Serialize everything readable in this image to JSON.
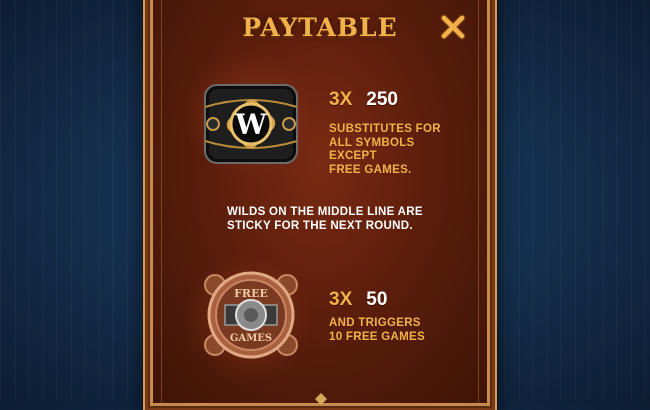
{
  "paytable": {
    "title": "PAYTABLE",
    "close_icon": "close-x-icon",
    "accent_color": "#f1b24a",
    "panel_color": "#5c1e0c",
    "background_color": "#15304f",
    "wild": {
      "symbol_icon": "wild-w-symbol",
      "symbol_letter": "W",
      "multiplier": "3X",
      "payout": "250",
      "description": "SUBSTITUTES FOR\nALL SYMBOLS\nEXCEPT\nFREE GAMES."
    },
    "note": "WILDS ON THE MIDDLE LINE ARE\nSTICKY FOR THE NEXT ROUND.",
    "free_games": {
      "symbol_icon": "free-games-dial-symbol",
      "symbol_text_top": "FREE",
      "symbol_text_bottom": "GAMES",
      "multiplier": "3X",
      "payout": "50",
      "description": "AND TRIGGERS\n10 FREE GAMES"
    },
    "scroll_icon": "scroll-down-arrow-icon"
  }
}
